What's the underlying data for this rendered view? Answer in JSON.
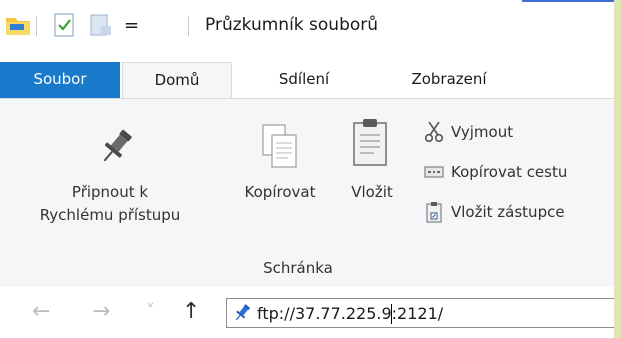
{
  "window": {
    "title": "Průzkumník souborů"
  },
  "quick_access": {
    "icons": [
      "folder-icon",
      "properties-icon",
      "new-folder-icon",
      "customize-qat-icon"
    ],
    "customize_glyph": "="
  },
  "tabs": [
    {
      "label": "Soubor",
      "type": "file"
    },
    {
      "label": "Domů",
      "active": true
    },
    {
      "label": "Sdílení"
    },
    {
      "label": "Zobrazení"
    }
  ],
  "ribbon": {
    "clipboard": {
      "pin": {
        "label_line1": "Připnout k",
        "label_line2": "Rychlému přístupu",
        "icon": "pin-icon"
      },
      "copy": {
        "label": "Kopírovat",
        "icon": "copy-icon"
      },
      "paste": {
        "label": "Vložit",
        "icon": "paste-icon"
      },
      "cut": {
        "label": "Vyjmout",
        "icon": "cut-icon"
      },
      "copy_path": {
        "label": "Kopírovat cestu",
        "icon": "copy-path-icon"
      },
      "paste_shortcut": {
        "label": "Vložit zástupce",
        "icon": "paste-shortcut-icon"
      },
      "group_label": "Schránka"
    }
  },
  "navigation": {
    "back_glyph": "←",
    "forward_glyph": "→",
    "recent_glyph": "˅",
    "up_glyph": "↑"
  },
  "address_bar": {
    "value": "ftp://37.77.225.9:2121/",
    "icon": "pin-icon"
  },
  "colors": {
    "file_tab": "#1979ca",
    "accent_pin": "#2a6fd6",
    "ribbon_bg": "#f5f6f7",
    "frame": "#dfe5b4"
  }
}
